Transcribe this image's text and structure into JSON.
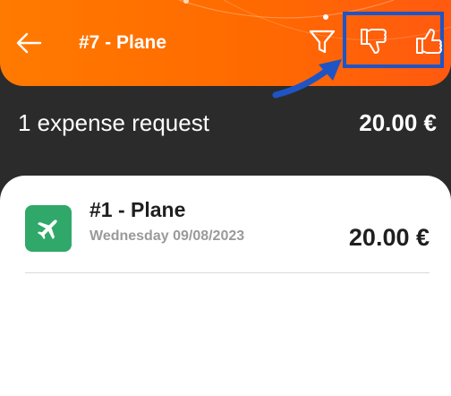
{
  "header": {
    "title": "#7 - Plane",
    "back_icon": "arrow-left-icon",
    "filter_icon": "filter-icon",
    "reject_icon": "thumbs-down-icon",
    "approve_icon": "thumbs-up-icon",
    "background_color": "#ff6a00",
    "annotation_color": "#1f54c4"
  },
  "summary": {
    "label": "1 expense request",
    "total": "20.00 €"
  },
  "expenses": [
    {
      "title": "#1 - Plane",
      "date": "Wednesday 09/08/2023",
      "amount": "20.00 €",
      "icon": "plane-icon",
      "icon_color": "#2fa869"
    }
  ]
}
